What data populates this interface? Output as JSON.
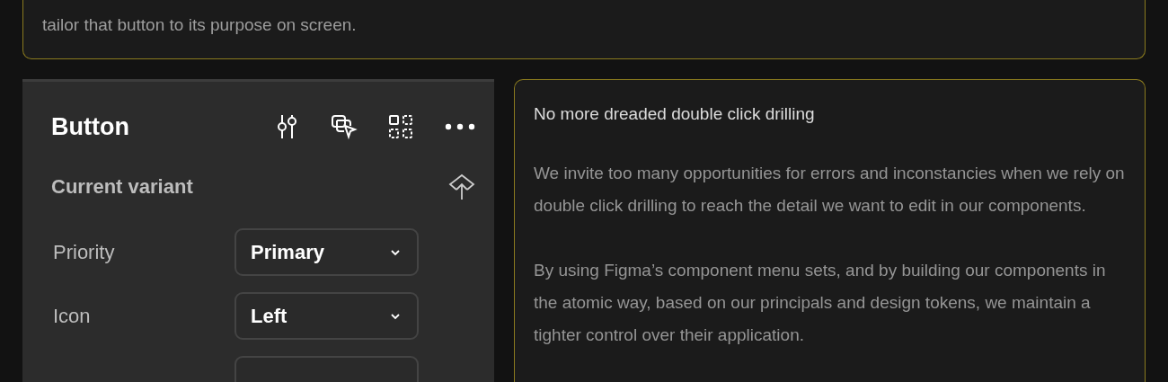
{
  "intro": {
    "text": "tailor that button to its purpose on screen."
  },
  "panel": {
    "title": "Button",
    "section": "Current variant",
    "properties": [
      {
        "kind": "dropdown",
        "label": "Priority",
        "value": "Primary"
      },
      {
        "kind": "dropdown",
        "label": "Icon",
        "value": "Left"
      },
      {
        "kind": "dropdown"
      }
    ]
  },
  "article": {
    "heading": "No more dreaded double click drilling",
    "paragraphs": [
      "We invite too many opportunities for errors and inconstancies when we rely on double click drilling to reach the detail we want to edit in our components.",
      "By using Figma’s component menu sets, and by building our components in the atomic way, based on our principals and design tokens, we maintain a tighter control over their application."
    ]
  }
}
